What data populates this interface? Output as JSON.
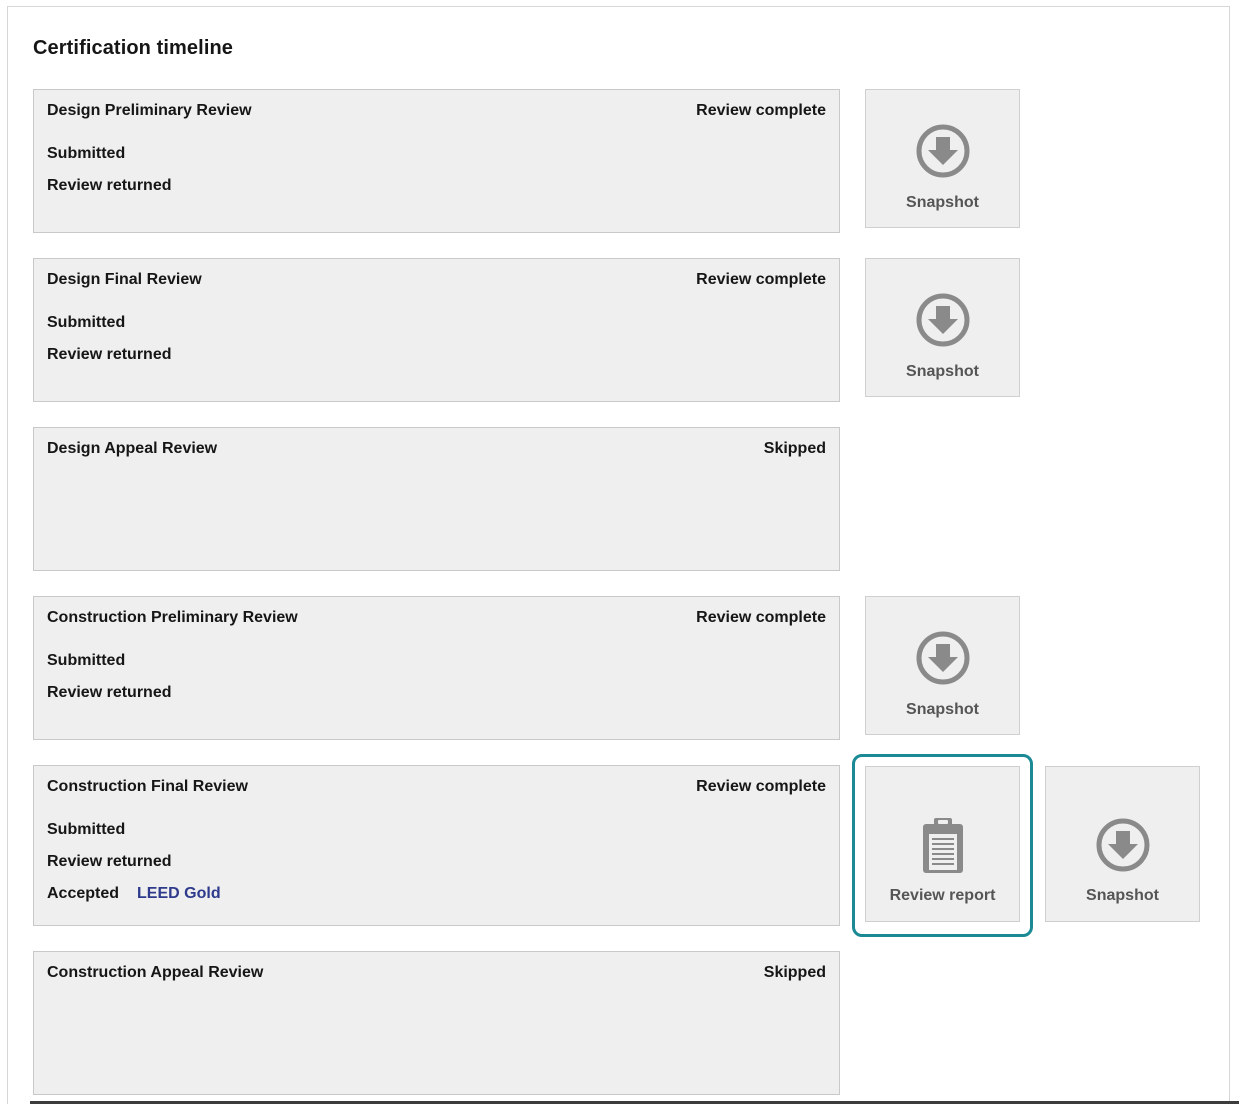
{
  "page": {
    "title": "Certification timeline"
  },
  "colors": {
    "accent_focus": "#1b8a95",
    "link": "#2e3a8c",
    "panel_bg": "#efefef"
  },
  "stages": [
    {
      "name": "Design Preliminary Review",
      "status": "Review complete",
      "lines": [
        "Submitted",
        "Review returned"
      ],
      "actions": [
        {
          "label": "Snapshot",
          "icon": "download-circle-icon"
        }
      ]
    },
    {
      "name": "Design Final Review",
      "status": "Review complete",
      "lines": [
        "Submitted",
        "Review returned"
      ],
      "actions": [
        {
          "label": "Snapshot",
          "icon": "download-circle-icon"
        }
      ]
    },
    {
      "name": "Design Appeal Review",
      "status": "Skipped",
      "lines": [],
      "actions": []
    },
    {
      "name": "Construction Preliminary Review",
      "status": "Review complete",
      "lines": [
        "Submitted",
        "Review returned"
      ],
      "actions": [
        {
          "label": "Snapshot",
          "icon": "download-circle-icon"
        }
      ]
    },
    {
      "name": "Construction Final Review",
      "status": "Review complete",
      "lines": [
        "Submitted",
        "Review returned",
        "Accepted"
      ],
      "certification_level": "LEED Gold",
      "actions": [
        {
          "label": "Review report",
          "icon": "clipboard-icon",
          "focused": true
        },
        {
          "label": "Snapshot",
          "icon": "download-circle-icon"
        }
      ]
    },
    {
      "name": "Construction Appeal Review",
      "status": "Skipped",
      "lines": [],
      "actions": []
    }
  ]
}
